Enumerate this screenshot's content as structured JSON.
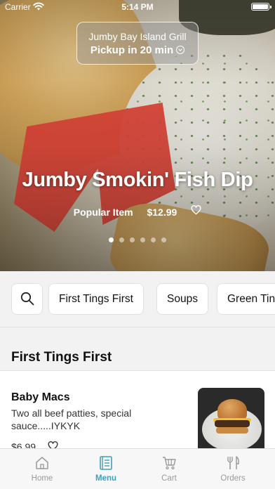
{
  "status_bar": {
    "carrier": "Carrier",
    "time": "5:14 PM",
    "battery_level": 1.0
  },
  "hero": {
    "restaurant_name": "Jumby Bay Island Grill",
    "pickup_text": "Pickup in 20 min",
    "title": "Jumby Smokin' Fish Dip",
    "tag": "Popular Item",
    "price": "$12.99",
    "carousel_count": 6,
    "carousel_active": 1
  },
  "categories": {
    "items": [
      "First Tings First",
      "Soups",
      "Green Tings"
    ]
  },
  "section": {
    "title": "First Tings First"
  },
  "menu_item": {
    "name": "Baby Macs",
    "description": "Two all beef patties, special sauce.....IYKYK",
    "price": "$6.99"
  },
  "tab_bar": {
    "tabs": [
      {
        "label": "Home",
        "icon": "home-icon"
      },
      {
        "label": "Menu",
        "icon": "menu-book-icon"
      },
      {
        "label": "Cart",
        "icon": "cart-icon"
      },
      {
        "label": "Orders",
        "icon": "fork-knife-icon"
      }
    ],
    "active": "Menu"
  },
  "colors": {
    "accent": "#3aa0c2",
    "inactive": "#9a9a9a"
  }
}
